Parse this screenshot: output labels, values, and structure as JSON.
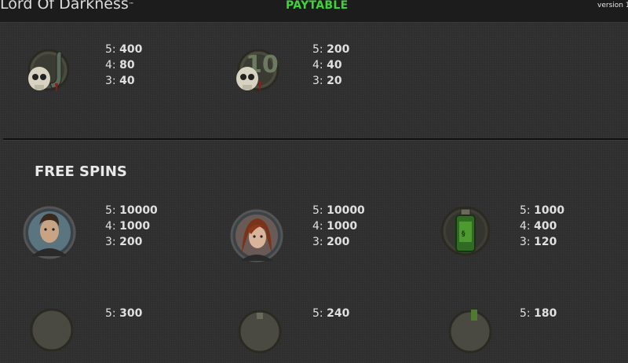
{
  "header": {
    "game_title": "Lord Of Darkness",
    "trademark": "™",
    "paytable_label": "PAYTABLE",
    "version_label": "version 1"
  },
  "top_symbols": [
    {
      "icon": "skull-j-icon",
      "pays": [
        {
          "n": "5",
          "v": "400"
        },
        {
          "n": "4",
          "v": "80"
        },
        {
          "n": "3",
          "v": "40"
        }
      ]
    },
    {
      "icon": "skull-10-icon",
      "pays": [
        {
          "n": "5",
          "v": "200"
        },
        {
          "n": "4",
          "v": "40"
        },
        {
          "n": "3",
          "v": "20"
        }
      ]
    }
  ],
  "free_spins": {
    "heading": "FREE SPINS",
    "symbols": [
      {
        "icon": "man-portrait-icon",
        "pays": [
          {
            "n": "5",
            "v": "10000"
          },
          {
            "n": "4",
            "v": "1000"
          },
          {
            "n": "3",
            "v": "200"
          }
        ]
      },
      {
        "icon": "woman-portrait-icon",
        "pays": [
          {
            "n": "5",
            "v": "10000"
          },
          {
            "n": "4",
            "v": "1000"
          },
          {
            "n": "3",
            "v": "200"
          }
        ]
      },
      {
        "icon": "potion-bottle-icon",
        "pays": [
          {
            "n": "5",
            "v": "1000"
          },
          {
            "n": "4",
            "v": "400"
          },
          {
            "n": "3",
            "v": "120"
          }
        ]
      }
    ]
  },
  "bottom_partial": [
    {
      "icon": "partial-symbol-icon",
      "pays": [
        {
          "n": "5",
          "v": "300"
        }
      ]
    },
    {
      "icon": "partial-symbol-icon",
      "pays": [
        {
          "n": "5",
          "v": "240"
        }
      ]
    },
    {
      "icon": "partial-symbol-icon",
      "pays": [
        {
          "n": "5",
          "v": "180"
        }
      ]
    }
  ],
  "colors": {
    "accent": "#3fd33a",
    "background": "#2e2e2e",
    "topbar": "#1c1c1c"
  }
}
